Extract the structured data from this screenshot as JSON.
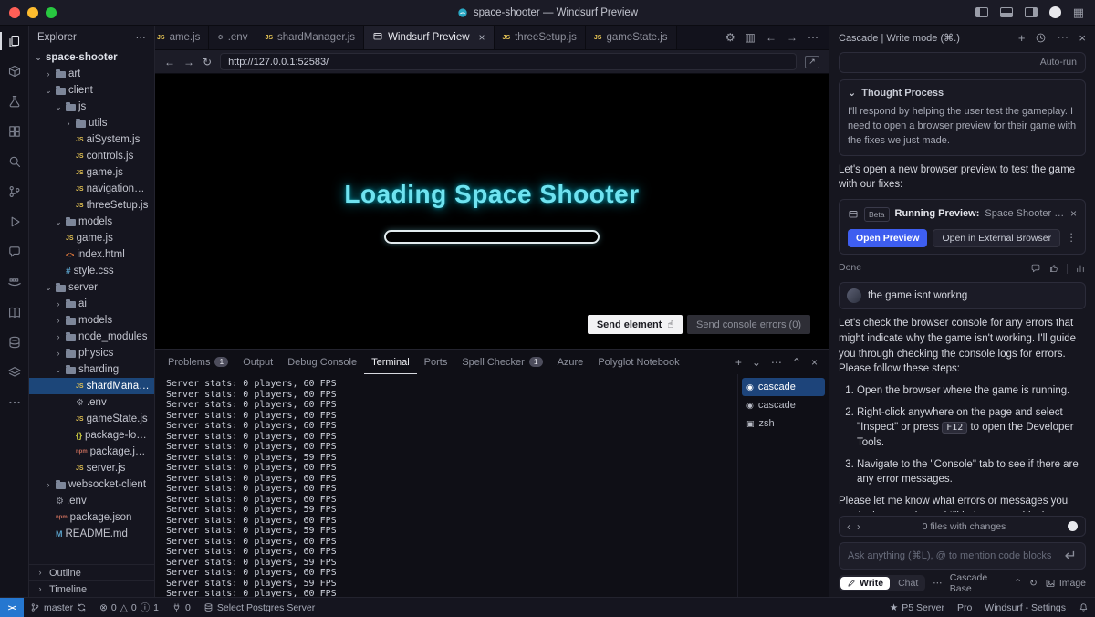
{
  "titlebar": {
    "title": "space-shooter — Windsurf Preview"
  },
  "activity_bar": {
    "items": [
      {
        "name": "explorer",
        "icon": "files",
        "active": true
      },
      {
        "name": "packages",
        "icon": "box"
      },
      {
        "name": "testing",
        "icon": "flask"
      },
      {
        "name": "extensions",
        "icon": "ext"
      },
      {
        "name": "search",
        "icon": "search"
      },
      {
        "name": "source-control",
        "icon": "git"
      },
      {
        "name": "run-debug",
        "icon": "play"
      },
      {
        "name": "comments",
        "icon": "chat"
      },
      {
        "name": "containers",
        "icon": "whale"
      },
      {
        "name": "docs",
        "icon": "book"
      },
      {
        "name": "database",
        "icon": "db"
      },
      {
        "name": "infrastructure",
        "icon": "layers"
      },
      {
        "name": "more-actions",
        "icon": "dots"
      }
    ]
  },
  "explorer": {
    "header": "Explorer",
    "tree": [
      {
        "label": "space-shooter",
        "level": 0,
        "icon": "none",
        "chevron": "open",
        "selected": false
      },
      {
        "label": "art",
        "level": 1,
        "icon": "folder",
        "chevron": "closed",
        "selected": false
      },
      {
        "label": "client",
        "level": 1,
        "icon": "folder",
        "chevron": "open",
        "selected": false
      },
      {
        "label": "js",
        "level": 2,
        "icon": "folder",
        "chevron": "open",
        "selected": false
      },
      {
        "label": "utils",
        "level": 3,
        "icon": "folder",
        "chevron": "closed",
        "selected": false
      },
      {
        "label": "aiSystem.js",
        "level": 3,
        "icon": "js",
        "chevron": "none",
        "selected": false
      },
      {
        "label": "controls.js",
        "level": 3,
        "icon": "js",
        "chevron": "none",
        "selected": false
      },
      {
        "label": "game.js",
        "level": 3,
        "icon": "js",
        "chevron": "none",
        "selected": false
      },
      {
        "label": "navigationSys...",
        "level": 3,
        "icon": "js",
        "chevron": "none",
        "selected": false
      },
      {
        "label": "threeSetup.js",
        "level": 3,
        "icon": "js",
        "chevron": "none",
        "selected": false
      },
      {
        "label": "models",
        "level": 2,
        "icon": "folder",
        "chevron": "open",
        "selected": false
      },
      {
        "label": "game.js",
        "level": 2,
        "icon": "js",
        "chevron": "none",
        "selected": false
      },
      {
        "label": "index.html",
        "level": 2,
        "icon": "html",
        "chevron": "none",
        "selected": false
      },
      {
        "label": "style.css",
        "level": 2,
        "icon": "css",
        "chevron": "none",
        "selected": false
      },
      {
        "label": "server",
        "level": 1,
        "icon": "folder",
        "chevron": "open",
        "selected": false
      },
      {
        "label": "ai",
        "level": 2,
        "icon": "folder",
        "chevron": "closed",
        "selected": false
      },
      {
        "label": "models",
        "level": 2,
        "icon": "folder",
        "chevron": "closed",
        "selected": false
      },
      {
        "label": "node_modules",
        "level": 2,
        "icon": "folder",
        "chevron": "closed",
        "selected": false
      },
      {
        "label": "physics",
        "level": 2,
        "icon": "folder",
        "chevron": "closed",
        "selected": false
      },
      {
        "label": "sharding",
        "level": 2,
        "icon": "folder",
        "chevron": "open",
        "selected": false
      },
      {
        "label": "shardManager.js",
        "level": 3,
        "icon": "js",
        "chevron": "none",
        "selected": true
      },
      {
        "label": ".env",
        "level": 3,
        "icon": "env",
        "chevron": "none",
        "selected": false
      },
      {
        "label": "gameState.js",
        "level": 3,
        "icon": "js",
        "chevron": "none",
        "selected": false
      },
      {
        "label": "package-lock.j...",
        "level": 3,
        "icon": "json",
        "chevron": "none",
        "selected": false
      },
      {
        "label": "package.json",
        "level": 3,
        "icon": "npm",
        "chevron": "none",
        "selected": false
      },
      {
        "label": "server.js",
        "level": 3,
        "icon": "js",
        "chevron": "none",
        "selected": false
      },
      {
        "label": "websocket-client",
        "level": 1,
        "icon": "folder",
        "chevron": "closed",
        "selected": false
      },
      {
        "label": ".env",
        "level": 1,
        "icon": "env",
        "chevron": "none",
        "selected": false
      },
      {
        "label": "package.json",
        "level": 1,
        "icon": "npm",
        "chevron": "none",
        "selected": false
      },
      {
        "label": "README.md",
        "level": 1,
        "icon": "md",
        "chevron": "none",
        "selected": false
      }
    ],
    "sections": [
      "Outline",
      "Timeline"
    ]
  },
  "tabs": {
    "items": [
      {
        "label": "ame.js",
        "icon": "js",
        "clipped": true
      },
      {
        "label": ".env",
        "icon": "gear"
      },
      {
        "label": "shardManager.js",
        "icon": "js"
      },
      {
        "label": "Windsurf Preview",
        "icon": "preview",
        "active": true
      },
      {
        "label": "threeSetup.js",
        "icon": "js"
      },
      {
        "label": "gameState.js",
        "icon": "js"
      }
    ]
  },
  "preview": {
    "url": "http://127.0.0.1:52583/",
    "heading": "Loading Space Shooter",
    "send_element": "Send element",
    "send_console": "Send console errors (0)"
  },
  "panel": {
    "tabs": [
      {
        "label": "Problems",
        "badge": "1"
      },
      {
        "label": "Output"
      },
      {
        "label": "Debug Console"
      },
      {
        "label": "Terminal",
        "active": true
      },
      {
        "label": "Ports"
      },
      {
        "label": "Spell Checker",
        "badge": "1"
      },
      {
        "label": "Azure"
      },
      {
        "label": "Polyglot Notebook"
      }
    ],
    "terminal_lines": [
      "Server stats: 0 players, 60 FPS",
      "Server stats: 0 players, 60 FPS",
      "Server stats: 0 players, 60 FPS",
      "Server stats: 0 players, 60 FPS",
      "Server stats: 0 players, 60 FPS",
      "Server stats: 0 players, 60 FPS",
      "Server stats: 0 players, 60 FPS",
      "Server stats: 0 players, 59 FPS",
      "Server stats: 0 players, 60 FPS",
      "Server stats: 0 players, 60 FPS",
      "Server stats: 0 players, 60 FPS",
      "Server stats: 0 players, 60 FPS",
      "Server stats: 0 players, 59 FPS",
      "Server stats: 0 players, 60 FPS",
      "Server stats: 0 players, 59 FPS",
      "Server stats: 0 players, 60 FPS",
      "Server stats: 0 players, 60 FPS",
      "Server stats: 0 players, 59 FPS",
      "Server stats: 0 players, 60 FPS",
      "Server stats: 0 players, 59 FPS",
      "Server stats: 0 players, 60 FPS"
    ],
    "terminals": [
      {
        "label": "cascade",
        "icon": "cascade",
        "selected": true
      },
      {
        "label": "cascade",
        "icon": "cascade"
      },
      {
        "label": "zsh",
        "icon": "zsh"
      }
    ]
  },
  "cascade": {
    "header": "Cascade | Write mode (⌘.)",
    "autorun": "Auto-run",
    "thought": {
      "title": "Thought Process",
      "body": "I'll respond by helping the user test the gameplay. I need to open a browser preview for their game with the fixes we just made."
    },
    "intro": "Let's open a new browser preview to test the game with our fixes:",
    "preview_card": {
      "beta": "Beta",
      "title": "Running Preview:",
      "subtitle": "Space Shooter Game",
      "open_preview": "Open Preview",
      "open_external": "Open in External Browser"
    },
    "done": "Done",
    "user_message": "the game isnt workng",
    "response_intro": "Let's check the browser console for any errors that might indicate why the game isn't working. I'll guide you through checking the console logs for errors. Please follow these steps:",
    "steps": [
      {
        "pre": "Open the browser where the game is running."
      },
      {
        "pre": "Right-click anywhere on the page and select \"Inspect\" or press ",
        "key": "F12",
        "post": " to open the Developer Tools."
      },
      {
        "pre": "Navigate to the \"Console\" tab to see if there are any error messages."
      }
    ],
    "response_outro": "Please let me know what errors or messages you see in the console, and I'll help you troubleshoot further!",
    "files_changes": "0 files with changes",
    "input_placeholder": "Ask anything (⌘L), @ to mention code blocks",
    "mode_write": "Write",
    "mode_chat": "Chat",
    "model": "Cascade Base",
    "image_label": "Image"
  },
  "statusbar": {
    "remote": "><",
    "branch": "master",
    "errors": "0",
    "warnings": "0",
    "infos": "1",
    "ports": "0",
    "postgres": "Select Postgres Server",
    "p5": "P5 Server",
    "pro": "Pro",
    "settings": "Windsurf - Settings"
  },
  "glyphs": {
    "close": "×",
    "back": "←",
    "forward": "→",
    "reload": "↻",
    "more": "⋯",
    "kebab": "⋮",
    "plus": "+",
    "chevron_down": "⌄",
    "chevron_up": "⌃",
    "chevron_right": "›",
    "chevron_left": "‹",
    "gear": "⚙",
    "external": "↗",
    "pointer": "☝",
    "enter": "↵",
    "grid": "▦",
    "star": "★",
    "split": "▥",
    "error": "⊗",
    "warning": "△",
    "info": "ⓘ",
    "file_js": "JS",
    "file_json": "{}",
    "file_css": "#",
    "file_html": "<>",
    "file_md": "M",
    "file_npm": "npm",
    "file_env": "⚙",
    "term_cascade": "◉",
    "term_zsh": "▣"
  }
}
